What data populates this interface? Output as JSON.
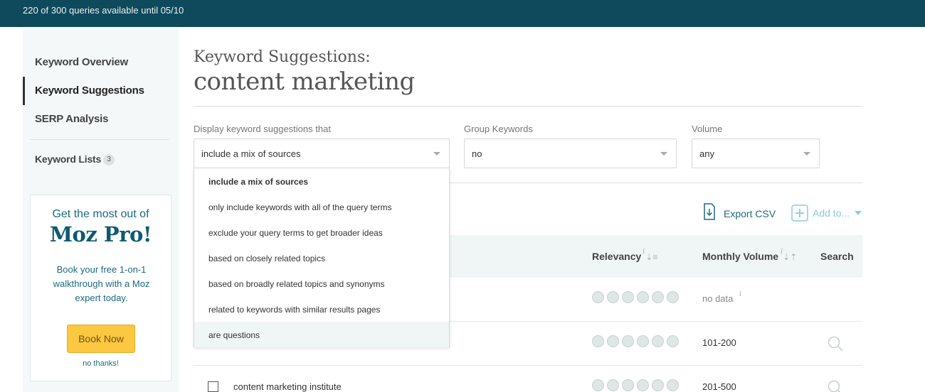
{
  "topbar": {
    "quota_text": "220 of 300 queries available until 05/10"
  },
  "sidebar": {
    "items": [
      {
        "label": "Keyword Overview"
      },
      {
        "label": "Keyword Suggestions"
      },
      {
        "label": "SERP Analysis"
      }
    ],
    "lists": {
      "label": "Keyword Lists",
      "count": "3"
    }
  },
  "promo": {
    "kicker": "Get the most out of",
    "title": "Moz Pro!",
    "body": "Book your free 1-on-1 walkthrough with a Moz expert today.",
    "button": "Book Now",
    "dismiss": "no thanks!"
  },
  "main": {
    "title": "Keyword Suggestions:",
    "query": "content marketing"
  },
  "filters": {
    "display": {
      "label": "Display keyword suggestions that",
      "value": "include a mix of sources",
      "options": [
        "include a mix of sources",
        "only include keywords with all of the query terms",
        "exclude your query terms to get broader ideas",
        "based on closely related topics",
        "based on broadly related topics and synonyms",
        "related to keywords with similar results pages",
        "are questions"
      ]
    },
    "group": {
      "label": "Group Keywords",
      "value": "no"
    },
    "volume": {
      "label": "Volume",
      "value": "any"
    }
  },
  "actions": {
    "export": "Export CSV",
    "add_to": "Add to..."
  },
  "table": {
    "columns": {
      "relevancy": "Relevancy",
      "volume": "Monthly Volume",
      "search": "Search"
    },
    "info_glyph": "i",
    "rows": [
      {
        "keyword": "",
        "volume": "no data"
      },
      {
        "keyword": "",
        "volume": "101-200"
      },
      {
        "keyword": "content marketing institute",
        "volume": "201-500"
      }
    ]
  },
  "colors": {
    "topbar": "#0e4a5c",
    "brand": "#0e5a72",
    "accent": "#1c6a82",
    "book_button": "#fcc741",
    "dropdown_hover": "#f0f5f5"
  },
  "icons": {
    "export": "download-document-icon",
    "add": "plus-square-icon",
    "search": "magnifier-icon",
    "sort": "sort-icon",
    "caret": "chevron-down-icon"
  }
}
